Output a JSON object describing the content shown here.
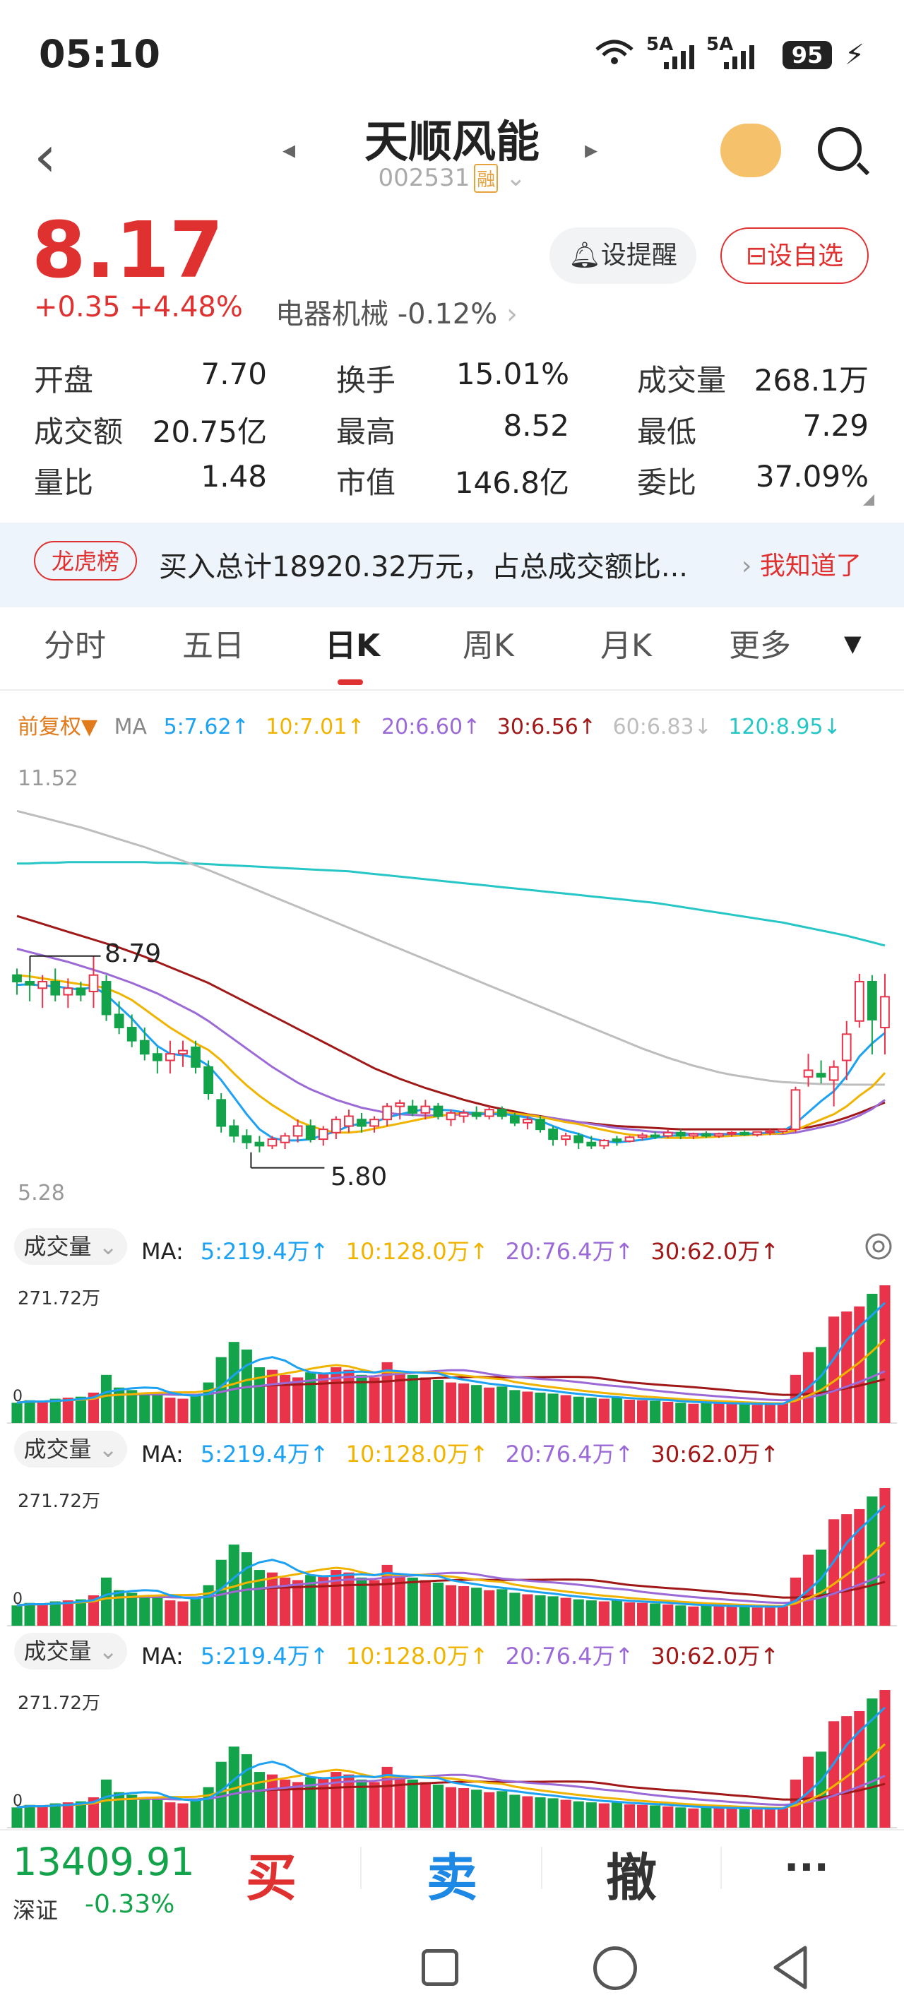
{
  "status": {
    "time": "05:10",
    "signal1": "5A",
    "signal2": "5A",
    "battery": "95"
  },
  "header": {
    "title": "天顺风能",
    "code": "002531",
    "badge": "融"
  },
  "quote": {
    "price": "8.17",
    "change": "+0.35",
    "change_pct": "+4.48%",
    "industry": "电器机械",
    "industry_change": "-0.12%",
    "alert_label": "设提醒",
    "watch_label": "设自选"
  },
  "stats": [
    [
      {
        "label": "开盘",
        "value": "7.70",
        "color": "green"
      },
      {
        "label": "换手",
        "value": "15.01%",
        "color": "black"
      },
      {
        "label": "成交量",
        "value": "268.1万",
        "color": "black"
      }
    ],
    [
      {
        "label": "成交额",
        "value": "20.75亿",
        "color": "black"
      },
      {
        "label": "最高",
        "value": "8.52",
        "color": "red"
      },
      {
        "label": "最低",
        "value": "7.29",
        "color": "green"
      }
    ],
    [
      {
        "label": "量比",
        "value": "1.48",
        "color": "black"
      },
      {
        "label": "市值",
        "value": "146.8亿",
        "color": "black"
      },
      {
        "label": "委比",
        "value": "37.09%",
        "color": "red"
      }
    ]
  ],
  "dragon_tiger": {
    "tag": "龙虎榜",
    "text": "买入总计18920.32万元，占总成交额比...",
    "action": "我知道了"
  },
  "tabs": [
    "分时",
    "五日",
    "日K",
    "周K",
    "月K",
    "更多"
  ],
  "ma_header": {
    "adjust": "前复权▼",
    "label": "MA",
    "ma5": "5:7.62↑",
    "ma10": "10:7.01↑",
    "ma20": "20:6.60↑",
    "ma30": "30:6.56↑",
    "ma60": "60:6.83↓",
    "ma120": "120:8.95↓"
  },
  "colors": {
    "ma5": "#1da1f2",
    "ma10": "#f0b400",
    "ma20": "#9b6ad6",
    "ma30": "#a01818",
    "ma60": "#bdbdbd",
    "ma120": "#26c6c6",
    "up": "#e8334a",
    "down": "#13a34a"
  },
  "chart_data": {
    "type": "candlestick",
    "y_max_label": "11.52",
    "y_min_label": "5.28",
    "high_annotation": "8.79",
    "low_annotation": "5.80",
    "ylim": [
      5.28,
      11.52
    ],
    "candles": [
      [
        8.5,
        8.6,
        8.2,
        8.4
      ],
      [
        8.4,
        8.55,
        8.1,
        8.35
      ],
      [
        8.3,
        8.5,
        8.0,
        8.4
      ],
      [
        8.4,
        8.6,
        8.1,
        8.2
      ],
      [
        8.2,
        8.45,
        8.0,
        8.3
      ],
      [
        8.3,
        8.4,
        8.1,
        8.2
      ],
      [
        8.25,
        8.79,
        8.0,
        8.5
      ],
      [
        8.4,
        8.5,
        7.8,
        7.9
      ],
      [
        7.9,
        8.1,
        7.6,
        7.7
      ],
      [
        7.7,
        7.9,
        7.4,
        7.5
      ],
      [
        7.5,
        7.7,
        7.2,
        7.3
      ],
      [
        7.3,
        7.4,
        7.0,
        7.2
      ],
      [
        7.2,
        7.5,
        7.0,
        7.3
      ],
      [
        7.3,
        7.5,
        7.1,
        7.35
      ],
      [
        7.4,
        7.5,
        7.0,
        7.1
      ],
      [
        7.1,
        7.2,
        6.6,
        6.7
      ],
      [
        6.6,
        6.7,
        6.1,
        6.2
      ],
      [
        6.2,
        6.3,
        5.95,
        6.05
      ],
      [
        6.05,
        6.15,
        5.85,
        5.95
      ],
      [
        5.95,
        6.05,
        5.8,
        5.9
      ],
      [
        5.9,
        6.05,
        5.85,
        6.0
      ],
      [
        5.95,
        6.1,
        5.85,
        6.05
      ],
      [
        6.05,
        6.3,
        5.95,
        6.2
      ],
      [
        6.2,
        6.3,
        5.95,
        6.0
      ],
      [
        6.0,
        6.2,
        5.9,
        6.15
      ],
      [
        6.1,
        6.35,
        6.0,
        6.3
      ],
      [
        6.2,
        6.45,
        6.1,
        6.35
      ],
      [
        6.3,
        6.4,
        6.1,
        6.2
      ],
      [
        6.2,
        6.35,
        6.1,
        6.3
      ],
      [
        6.3,
        6.55,
        6.2,
        6.5
      ],
      [
        6.5,
        6.6,
        6.3,
        6.55
      ],
      [
        6.5,
        6.6,
        6.35,
        6.4
      ],
      [
        6.4,
        6.6,
        6.3,
        6.5
      ],
      [
        6.5,
        6.55,
        6.3,
        6.35
      ],
      [
        6.3,
        6.45,
        6.2,
        6.4
      ],
      [
        6.35,
        6.45,
        6.25,
        6.4
      ],
      [
        6.4,
        6.5,
        6.3,
        6.35
      ],
      [
        6.35,
        6.5,
        6.3,
        6.45
      ],
      [
        6.45,
        6.5,
        6.3,
        6.35
      ],
      [
        6.35,
        6.4,
        6.2,
        6.25
      ],
      [
        6.25,
        6.35,
        6.15,
        6.3
      ],
      [
        6.3,
        6.35,
        6.1,
        6.15
      ],
      [
        6.15,
        6.2,
        5.9,
        6.0
      ],
      [
        6.0,
        6.1,
        5.9,
        6.05
      ],
      [
        6.05,
        6.1,
        5.85,
        5.95
      ],
      [
        5.95,
        6.05,
        5.85,
        5.9
      ],
      [
        5.9,
        6.0,
        5.85,
        5.98
      ],
      [
        6.0,
        6.05,
        5.9,
        5.97
      ],
      [
        5.97,
        6.05,
        5.95,
        6.03
      ],
      [
        6.03,
        6.1,
        5.98,
        6.06
      ],
      [
        6.06,
        6.12,
        6.0,
        6.05
      ],
      [
        6.05,
        6.15,
        6.02,
        6.1
      ],
      [
        6.1,
        6.15,
        6.0,
        6.05
      ],
      [
        6.05,
        6.1,
        6.0,
        6.08
      ],
      [
        6.08,
        6.12,
        6.02,
        6.05
      ],
      [
        6.05,
        6.1,
        6.02,
        6.08
      ],
      [
        6.08,
        6.12,
        6.04,
        6.1
      ],
      [
        6.1,
        6.14,
        6.05,
        6.07
      ],
      [
        6.07,
        6.12,
        6.04,
        6.11
      ],
      [
        6.11,
        6.15,
        6.06,
        6.12
      ],
      [
        6.12,
        6.16,
        6.08,
        6.15
      ],
      [
        6.15,
        6.8,
        6.1,
        6.75
      ],
      [
        6.95,
        7.3,
        6.8,
        7.05
      ],
      [
        7.0,
        7.2,
        6.85,
        6.95
      ],
      [
        6.9,
        7.2,
        6.5,
        7.1
      ],
      [
        7.2,
        7.8,
        6.9,
        7.6
      ],
      [
        7.8,
        8.52,
        7.7,
        8.4
      ],
      [
        8.4,
        8.5,
        7.29,
        7.82
      ],
      [
        7.7,
        8.52,
        7.29,
        8.17
      ]
    ],
    "ma5": [
      8.35,
      8.36,
      8.34,
      8.33,
      8.3,
      8.28,
      8.32,
      8.2,
      8.02,
      7.84,
      7.62,
      7.42,
      7.3,
      7.28,
      7.24,
      7.12,
      6.9,
      6.64,
      6.38,
      6.15,
      6.02,
      5.98,
      5.98,
      6.0,
      6.06,
      6.12,
      6.2,
      6.24,
      6.26,
      6.33,
      6.38,
      6.42,
      6.46,
      6.45,
      6.44,
      6.41,
      6.4,
      6.38,
      6.39,
      6.36,
      6.33,
      6.28,
      6.2,
      6.13,
      6.08,
      6.01,
      5.97,
      5.95,
      5.97,
      5.99,
      6.02,
      6.05,
      6.06,
      6.07,
      6.07,
      6.07,
      6.08,
      6.08,
      6.09,
      6.1,
      6.12,
      6.24,
      6.41,
      6.58,
      6.73,
      6.96,
      7.26,
      7.46,
      7.62
    ],
    "ma10": [
      8.5,
      8.48,
      8.45,
      8.42,
      8.39,
      8.36,
      8.34,
      8.3,
      8.22,
      8.12,
      7.98,
      7.84,
      7.7,
      7.58,
      7.46,
      7.36,
      7.2,
      7.0,
      6.82,
      6.66,
      6.52,
      6.4,
      6.28,
      6.2,
      6.14,
      6.1,
      6.1,
      6.12,
      6.16,
      6.2,
      6.24,
      6.28,
      6.32,
      6.35,
      6.38,
      6.4,
      6.4,
      6.4,
      6.41,
      6.39,
      6.37,
      6.34,
      6.3,
      6.26,
      6.23,
      6.18,
      6.14,
      6.1,
      6.07,
      6.05,
      6.03,
      6.02,
      6.02,
      6.02,
      6.03,
      6.04,
      6.05,
      6.06,
      6.07,
      6.08,
      6.09,
      6.14,
      6.22,
      6.3,
      6.38,
      6.5,
      6.66,
      6.8,
      7.01
    ],
    "ma20": [
      8.9,
      8.85,
      8.8,
      8.75,
      8.7,
      8.64,
      8.58,
      8.52,
      8.45,
      8.38,
      8.3,
      8.22,
      8.12,
      8.02,
      7.92,
      7.8,
      7.66,
      7.52,
      7.38,
      7.24,
      7.1,
      6.98,
      6.86,
      6.76,
      6.68,
      6.6,
      6.54,
      6.48,
      6.44,
      6.4,
      6.38,
      6.37,
      6.36,
      6.36,
      6.37,
      6.38,
      6.38,
      6.38,
      6.38,
      6.37,
      6.36,
      6.34,
      6.32,
      6.29,
      6.26,
      6.23,
      6.2,
      6.17,
      6.15,
      6.13,
      6.11,
      6.1,
      6.09,
      6.08,
      6.08,
      6.08,
      6.08,
      6.08,
      6.08,
      6.08,
      6.08,
      6.1,
      6.14,
      6.18,
      6.22,
      6.28,
      6.36,
      6.46,
      6.6
    ],
    "ma30": [
      9.4,
      9.34,
      9.28,
      9.22,
      9.16,
      9.1,
      9.04,
      8.98,
      8.92,
      8.85,
      8.78,
      8.7,
      8.62,
      8.54,
      8.46,
      8.38,
      8.28,
      8.18,
      8.08,
      7.98,
      7.88,
      7.78,
      7.68,
      7.58,
      7.48,
      7.38,
      7.28,
      7.18,
      7.08,
      7.0,
      6.92,
      6.85,
      6.78,
      6.72,
      6.66,
      6.6,
      6.55,
      6.5,
      6.46,
      6.42,
      6.38,
      6.35,
      6.32,
      6.29,
      6.26,
      6.24,
      6.22,
      6.2,
      6.19,
      6.18,
      6.17,
      6.16,
      6.15,
      6.15,
      6.15,
      6.15,
      6.15,
      6.15,
      6.15,
      6.15,
      6.15,
      6.16,
      6.18,
      6.22,
      6.27,
      6.33,
      6.4,
      6.48,
      6.56
    ],
    "ma60": [
      11.0,
      10.95,
      10.9,
      10.85,
      10.8,
      10.75,
      10.69,
      10.63,
      10.57,
      10.51,
      10.45,
      10.38,
      10.31,
      10.24,
      10.17,
      10.1,
      10.02,
      9.94,
      9.86,
      9.78,
      9.7,
      9.62,
      9.54,
      9.46,
      9.38,
      9.3,
      9.22,
      9.14,
      9.06,
      8.98,
      8.9,
      8.82,
      8.74,
      8.66,
      8.58,
      8.5,
      8.42,
      8.34,
      8.26,
      8.18,
      8.1,
      8.02,
      7.94,
      7.86,
      7.78,
      7.7,
      7.62,
      7.54,
      7.46,
      7.38,
      7.31,
      7.24,
      7.18,
      7.12,
      7.07,
      7.02,
      6.98,
      6.95,
      6.92,
      6.89,
      6.87,
      6.86,
      6.85,
      6.84,
      6.84,
      6.83,
      6.83,
      6.83,
      6.83
    ],
    "ma120": [
      10.2,
      10.2,
      10.21,
      10.21,
      10.22,
      10.22,
      10.22,
      10.22,
      10.22,
      10.22,
      10.22,
      10.21,
      10.21,
      10.2,
      10.2,
      10.19,
      10.18,
      10.17,
      10.16,
      10.15,
      10.14,
      10.13,
      10.12,
      10.11,
      10.1,
      10.09,
      10.08,
      10.06,
      10.04,
      10.02,
      10.0,
      9.98,
      9.96,
      9.94,
      9.92,
      9.9,
      9.88,
      9.86,
      9.84,
      9.82,
      9.8,
      9.78,
      9.76,
      9.74,
      9.72,
      9.7,
      9.68,
      9.66,
      9.64,
      9.62,
      9.6,
      9.57,
      9.54,
      9.51,
      9.48,
      9.45,
      9.42,
      9.39,
      9.36,
      9.33,
      9.3,
      9.26,
      9.22,
      9.18,
      9.14,
      9.1,
      9.05,
      9.0,
      8.95
    ],
    "volumes": [
      40,
      45,
      42,
      48,
      50,
      52,
      60,
      95,
      70,
      65,
      60,
      55,
      50,
      48,
      55,
      80,
      130,
      160,
      145,
      110,
      105,
      95,
      90,
      100,
      98,
      110,
      105,
      95,
      90,
      120,
      100,
      95,
      90,
      85,
      80,
      78,
      75,
      70,
      72,
      65,
      62,
      60,
      58,
      55,
      52,
      50,
      48,
      50,
      46,
      45,
      44,
      42,
      40,
      38,
      40,
      39,
      38,
      37,
      36,
      38,
      40,
      95,
      140,
      150,
      210,
      220,
      230,
      255,
      271.72
    ]
  },
  "volume_panels": [
    {
      "pill": "成交量",
      "ma_label": "MA:",
      "ma5": "5:219.4万↑",
      "ma10": "10:128.0万↑",
      "ma20": "20:76.4万↑",
      "ma30": "30:62.0万↑",
      "max": "271.72万",
      "zero": "0"
    },
    {
      "pill": "成交量",
      "ma_label": "MA:",
      "ma5": "5:219.4万↑",
      "ma10": "10:128.0万↑",
      "ma20": "20:76.4万↑",
      "ma30": "30:62.0万↑",
      "max": "271.72万",
      "zero": "0"
    },
    {
      "pill": "成交量",
      "ma_label": "MA:",
      "ma5": "5:219.4万↑",
      "ma10": "10:128.0万↑",
      "ma20": "20:76.4万↑",
      "ma30": "30:62.0万↑",
      "max": "271.72万",
      "zero": "0"
    }
  ],
  "footer": {
    "index_value": "13409.91",
    "index_name": "深证",
    "index_change": "-0.33%",
    "buy": "买",
    "sell": "卖",
    "cancel": "撤",
    "more": "···"
  }
}
